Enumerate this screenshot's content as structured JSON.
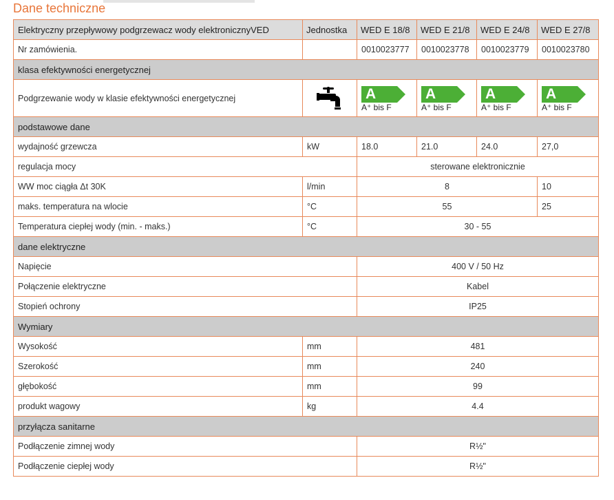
{
  "page_title": "Dane techniczne",
  "header": {
    "label": "Elektryczny przepływowy podgrzewacz wody elektronicznyVED",
    "unit": "Jednostka",
    "models": [
      "WED E 18/8",
      "WED E 21/8",
      "WED E 24/8",
      "WED E 27/8"
    ]
  },
  "rows": [
    {
      "type": "data",
      "label": "Nr zamówienia.",
      "unit": "",
      "cells": [
        {
          "text": "0010023777",
          "span": 1
        },
        {
          "text": "0010023778",
          "span": 1
        },
        {
          "text": "0010023779",
          "span": 1
        },
        {
          "text": "0010023780",
          "span": 1
        }
      ]
    },
    {
      "type": "section",
      "label": "klasa efektywności energetycznej"
    },
    {
      "type": "energy",
      "label": "Podgrzewanie wody w klasie efektywności energetycznej",
      "icon": "water-tap-icon",
      "classes": [
        {
          "cls": "A",
          "range": "A⁺ bis F"
        },
        {
          "cls": "A",
          "range": "A⁺ bis F"
        },
        {
          "cls": "A",
          "range": "A⁺ bis F"
        },
        {
          "cls": "A",
          "range": "A⁺ bis F"
        }
      ]
    },
    {
      "type": "section",
      "label": "podstawowe dane"
    },
    {
      "type": "data",
      "label": "wydajność grzewcza",
      "unit": "kW",
      "cells": [
        {
          "text": "18.0",
          "span": 1
        },
        {
          "text": "21.0",
          "span": 1
        },
        {
          "text": "24.0",
          "span": 1
        },
        {
          "text": "27,0",
          "span": 1
        }
      ]
    },
    {
      "type": "data",
      "label": "regulacja mocy",
      "cells": [
        {
          "text": "sterowane elektronicznie",
          "span": 4
        }
      ]
    },
    {
      "type": "data",
      "label": "WW moc ciągła Δt 30K",
      "unit": "l/min",
      "cells": [
        {
          "text": "8",
          "span": 3
        },
        {
          "text": "10",
          "span": 1
        }
      ]
    },
    {
      "type": "data",
      "label": "maks. temperatura na wlocie",
      "unit": "°C",
      "cells": [
        {
          "text": "55",
          "span": 3
        },
        {
          "text": "25",
          "span": 1
        }
      ]
    },
    {
      "type": "data",
      "label": "Temperatura ciepłej wody (min. - maks.)",
      "unit": "°C",
      "cells": [
        {
          "text": "30 - 55",
          "span": 4
        }
      ]
    },
    {
      "type": "section",
      "label": "dane elektryczne"
    },
    {
      "type": "data",
      "label": "Napięcie",
      "cells": [
        {
          "text": "400 V / 50 Hz",
          "span": 4
        }
      ]
    },
    {
      "type": "data",
      "label": "Połączenie elektryczne",
      "cells": [
        {
          "text": "Kabel",
          "span": 4
        }
      ]
    },
    {
      "type": "data",
      "label": "Stopień ochrony",
      "cells": [
        {
          "text": "IP25",
          "span": 4
        }
      ]
    },
    {
      "type": "section",
      "label": "Wymiary"
    },
    {
      "type": "data",
      "label": "Wysokość",
      "unit": "mm",
      "cells": [
        {
          "text": "481",
          "span": 4
        }
      ]
    },
    {
      "type": "data",
      "label": "Szerokość",
      "unit": "mm",
      "cells": [
        {
          "text": "240",
          "span": 4
        }
      ]
    },
    {
      "type": "data",
      "label": "głębokość",
      "unit": "mm",
      "cells": [
        {
          "text": "99",
          "span": 4
        }
      ]
    },
    {
      "type": "data",
      "label": "produkt wagowy",
      "unit": "kg",
      "cells": [
        {
          "text": "4.4",
          "span": 4
        }
      ]
    },
    {
      "type": "section",
      "label": "przyłącza sanitarne"
    },
    {
      "type": "data",
      "label": "Podłączenie zimnej wody",
      "cells": [
        {
          "text": "R½\"",
          "span": 4
        }
      ]
    },
    {
      "type": "data",
      "label": "Podłączenie ciepłej wody",
      "cells": [
        {
          "text": "R½\"",
          "span": 4
        }
      ]
    }
  ],
  "colors": {
    "accent": "#e8763a",
    "border": "#e8895a",
    "section_bg": "#cccccc",
    "energy_green": "#4caf36"
  }
}
